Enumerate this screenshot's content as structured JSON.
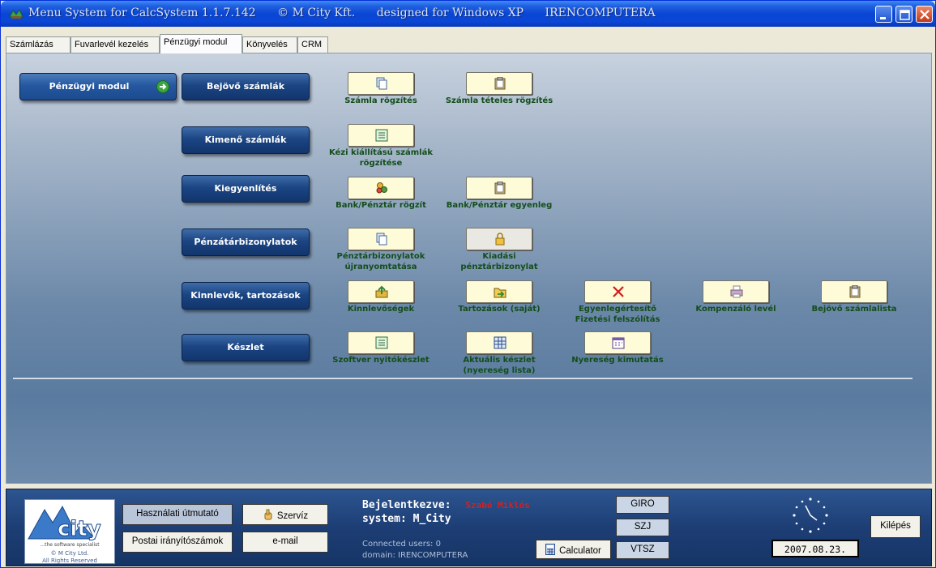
{
  "window": {
    "title_parts": [
      "Menu System for CalcSystem 1.1.7.142",
      "© M City Kft.",
      "designed for Windows XP",
      "IRENCOMPUTERA"
    ]
  },
  "tabs": [
    "Számlázás",
    "Fuvarlevél kezelés",
    "Pénzügyi modul",
    "Könyvelés",
    "CRM"
  ],
  "main_module": "Pénzügyi modul",
  "categories": [
    {
      "label": "Bejövő számlák",
      "actions": [
        {
          "label": "Számla rögzítés",
          "icon": "copy-icon"
        },
        {
          "label": "Számla tételes rögzítés",
          "icon": "clipboard-icon"
        }
      ]
    },
    {
      "label": "Kimenő számlák",
      "actions": [
        {
          "label": "Kézi kiállítású számlák\nrögzítése",
          "icon": "list-icon"
        }
      ]
    },
    {
      "label": "Kiegyenlítés",
      "actions": [
        {
          "label": "Bank/Pénztár rögzít",
          "icon": "users-icon"
        },
        {
          "label": "Bank/Pénztár egyenleg",
          "icon": "clipboard-icon"
        }
      ]
    },
    {
      "label": "Pénzátárbizonylatok",
      "actions": [
        {
          "label": "Pénztárbizonylatok\nújranyomtatása",
          "icon": "copy-icon"
        },
        {
          "label": "Kiadási\npénztárbizonylat",
          "icon": "lock-icon"
        }
      ]
    },
    {
      "label": "Kinnlevők, tartozások",
      "actions": [
        {
          "label": "Kinnlevőségek",
          "icon": "export-icon"
        },
        {
          "label": "Tartozások (saját)",
          "icon": "folder-arrow-icon"
        },
        {
          "label": "Egyenlegértesítő\nFizetési felszólítás",
          "icon": "x-icon"
        },
        {
          "label": "Kompenzáló levél",
          "icon": "printer-icon"
        },
        {
          "label": "Bejövő számlalista",
          "icon": "clipboard-icon"
        }
      ]
    },
    {
      "label": "Készlet",
      "actions": [
        {
          "label": "Szoftver nyitókészlet",
          "icon": "list-icon"
        },
        {
          "label": "Aktuális készlet\n(nyereség lista)",
          "icon": "grid-icon"
        },
        {
          "label": "Nyereség kimutatás",
          "icon": "calendar-icon"
        }
      ]
    }
  ],
  "status": {
    "logo_text": "city",
    "logo_tagline": "...the software specialist",
    "copyright_line1": "© M City Ltd.",
    "copyright_line2": "All Rights Reserved",
    "btn_manual": "Használati útmutató",
    "btn_postal": "Postai irányítószámok",
    "btn_service": "Szervíz",
    "btn_email": "e-mail",
    "logged_in_label": "Bejelentkezve:",
    "logged_in_user": "Szabó Miklós",
    "system": "system: M_City",
    "connected_users": "Connected users: 0",
    "domain": "domain: IRENCOMPUTERA",
    "btn_calculator": "Calculator",
    "btn_giro": "GIRO",
    "btn_szj": "SZJ",
    "btn_vtsz": "VTSZ",
    "date": "2007.08.23.",
    "btn_exit": "Kilépés"
  },
  "colors": {
    "title_bar": "#0a46d4",
    "category_button": "#1b4583",
    "action_label": "#134d1a",
    "user_name": "#d42020"
  }
}
